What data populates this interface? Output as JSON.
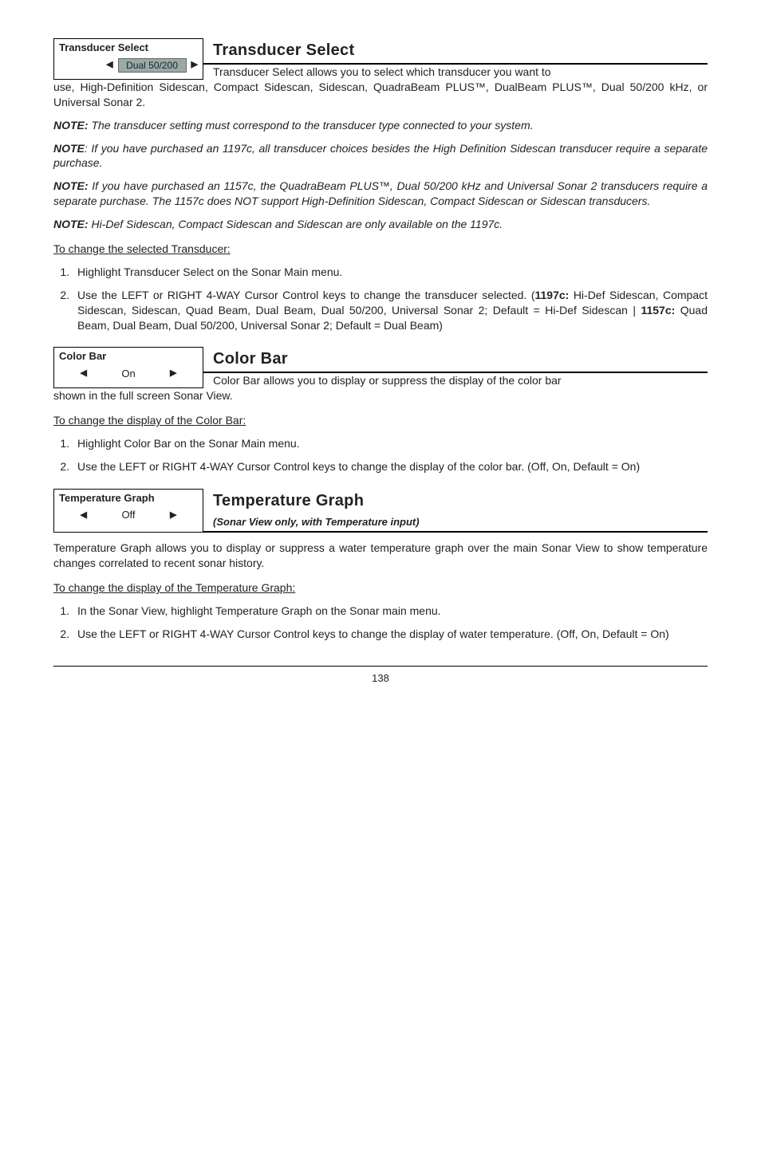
{
  "sections": [
    {
      "box_label": "Transducer Select",
      "box_value": "Dual 50/200",
      "box_style": "pill-right",
      "title": "Transducer Select",
      "subtitle": "",
      "lead": "Transducer Select",
      "lead_rest": " allows you to select which transducer you want to use, High-Definition Sidescan, Compact Sidescan, Sidescan, QuadraBeam PLUS™, DualBeam PLUS™, Dual 50/200 kHz, or Universal Sonar 2.",
      "notes": [
        {
          "bold": "NOTE:",
          "text": " The transducer setting must correspond to the transducer type connected to your system."
        },
        {
          "bold": "NOTE",
          "text": ": If you have purchased an 1197c, all transducer choices besides the High Definition Sidescan transducer require a separate purchase."
        },
        {
          "bold": "NOTE:",
          "text": "  If you have purchased an 1157c, the QuadraBeam PLUS™, Dual 50/200 kHz and Universal Sonar 2 transducers require a separate purchase. The 1157c does NOT support High-Definition Sidescan, Compact Sidescan or Sidescan transducers."
        },
        {
          "bold": "NOTE:",
          "text": " Hi-Def Sidescan, Compact Sidescan and Sidescan are only available on the 1197c."
        }
      ],
      "proc_head": "To change the selected Transducer:",
      "steps": [
        "Highlight Transducer Select on the Sonar Main menu.",
        "Use the LEFT or RIGHT 4-WAY Cursor Control keys to change the transducer selected. (1197c: Hi-Def Sidescan, Compact Sidescan, Sidescan, Quad Beam, Dual Beam, Dual 50/200, Universal Sonar 2; Default = Hi-Def Sidescan | 1157c: Quad Beam, Dual Beam, Dual 50/200, Universal Sonar 2; Default = Dual Beam)"
      ]
    },
    {
      "box_label": "Color Bar",
      "box_value": "On",
      "box_style": "plain-center",
      "title": "Color Bar",
      "subtitle": "",
      "lead": "Color Bar",
      "lead_rest": " allows you to display or suppress the display of the color bar shown in the full screen Sonar View.",
      "notes": [],
      "proc_head": "To change the display of the Color Bar:",
      "steps": [
        "Highlight Color Bar on the Sonar Main menu.",
        "Use the LEFT or RIGHT 4-WAY Cursor Control keys to change the display of the color bar. (Off, On, Default = On)"
      ]
    },
    {
      "box_label": "Temperature Graph",
      "box_value": "Off",
      "box_style": "plain-center",
      "title": "Temperature Graph",
      "subtitle": "(Sonar View only, with Temperature input)",
      "lead": "Temperature Graph",
      "lead_rest": " allows you to display or suppress a water temperature graph over the main Sonar View to show temperature changes correlated to recent sonar history.",
      "notes": [],
      "proc_head": "To change the display of the Temperature Graph:",
      "steps": [
        "In the Sonar View, highlight Temperature Graph on the Sonar main menu.",
        "Use the LEFT or RIGHT 4-WAY Cursor Control keys to change the display of water temperature. (Off, On, Default = On)"
      ]
    }
  ],
  "page_number": "138",
  "arrow_left": "◀",
  "arrow_right": "▶"
}
